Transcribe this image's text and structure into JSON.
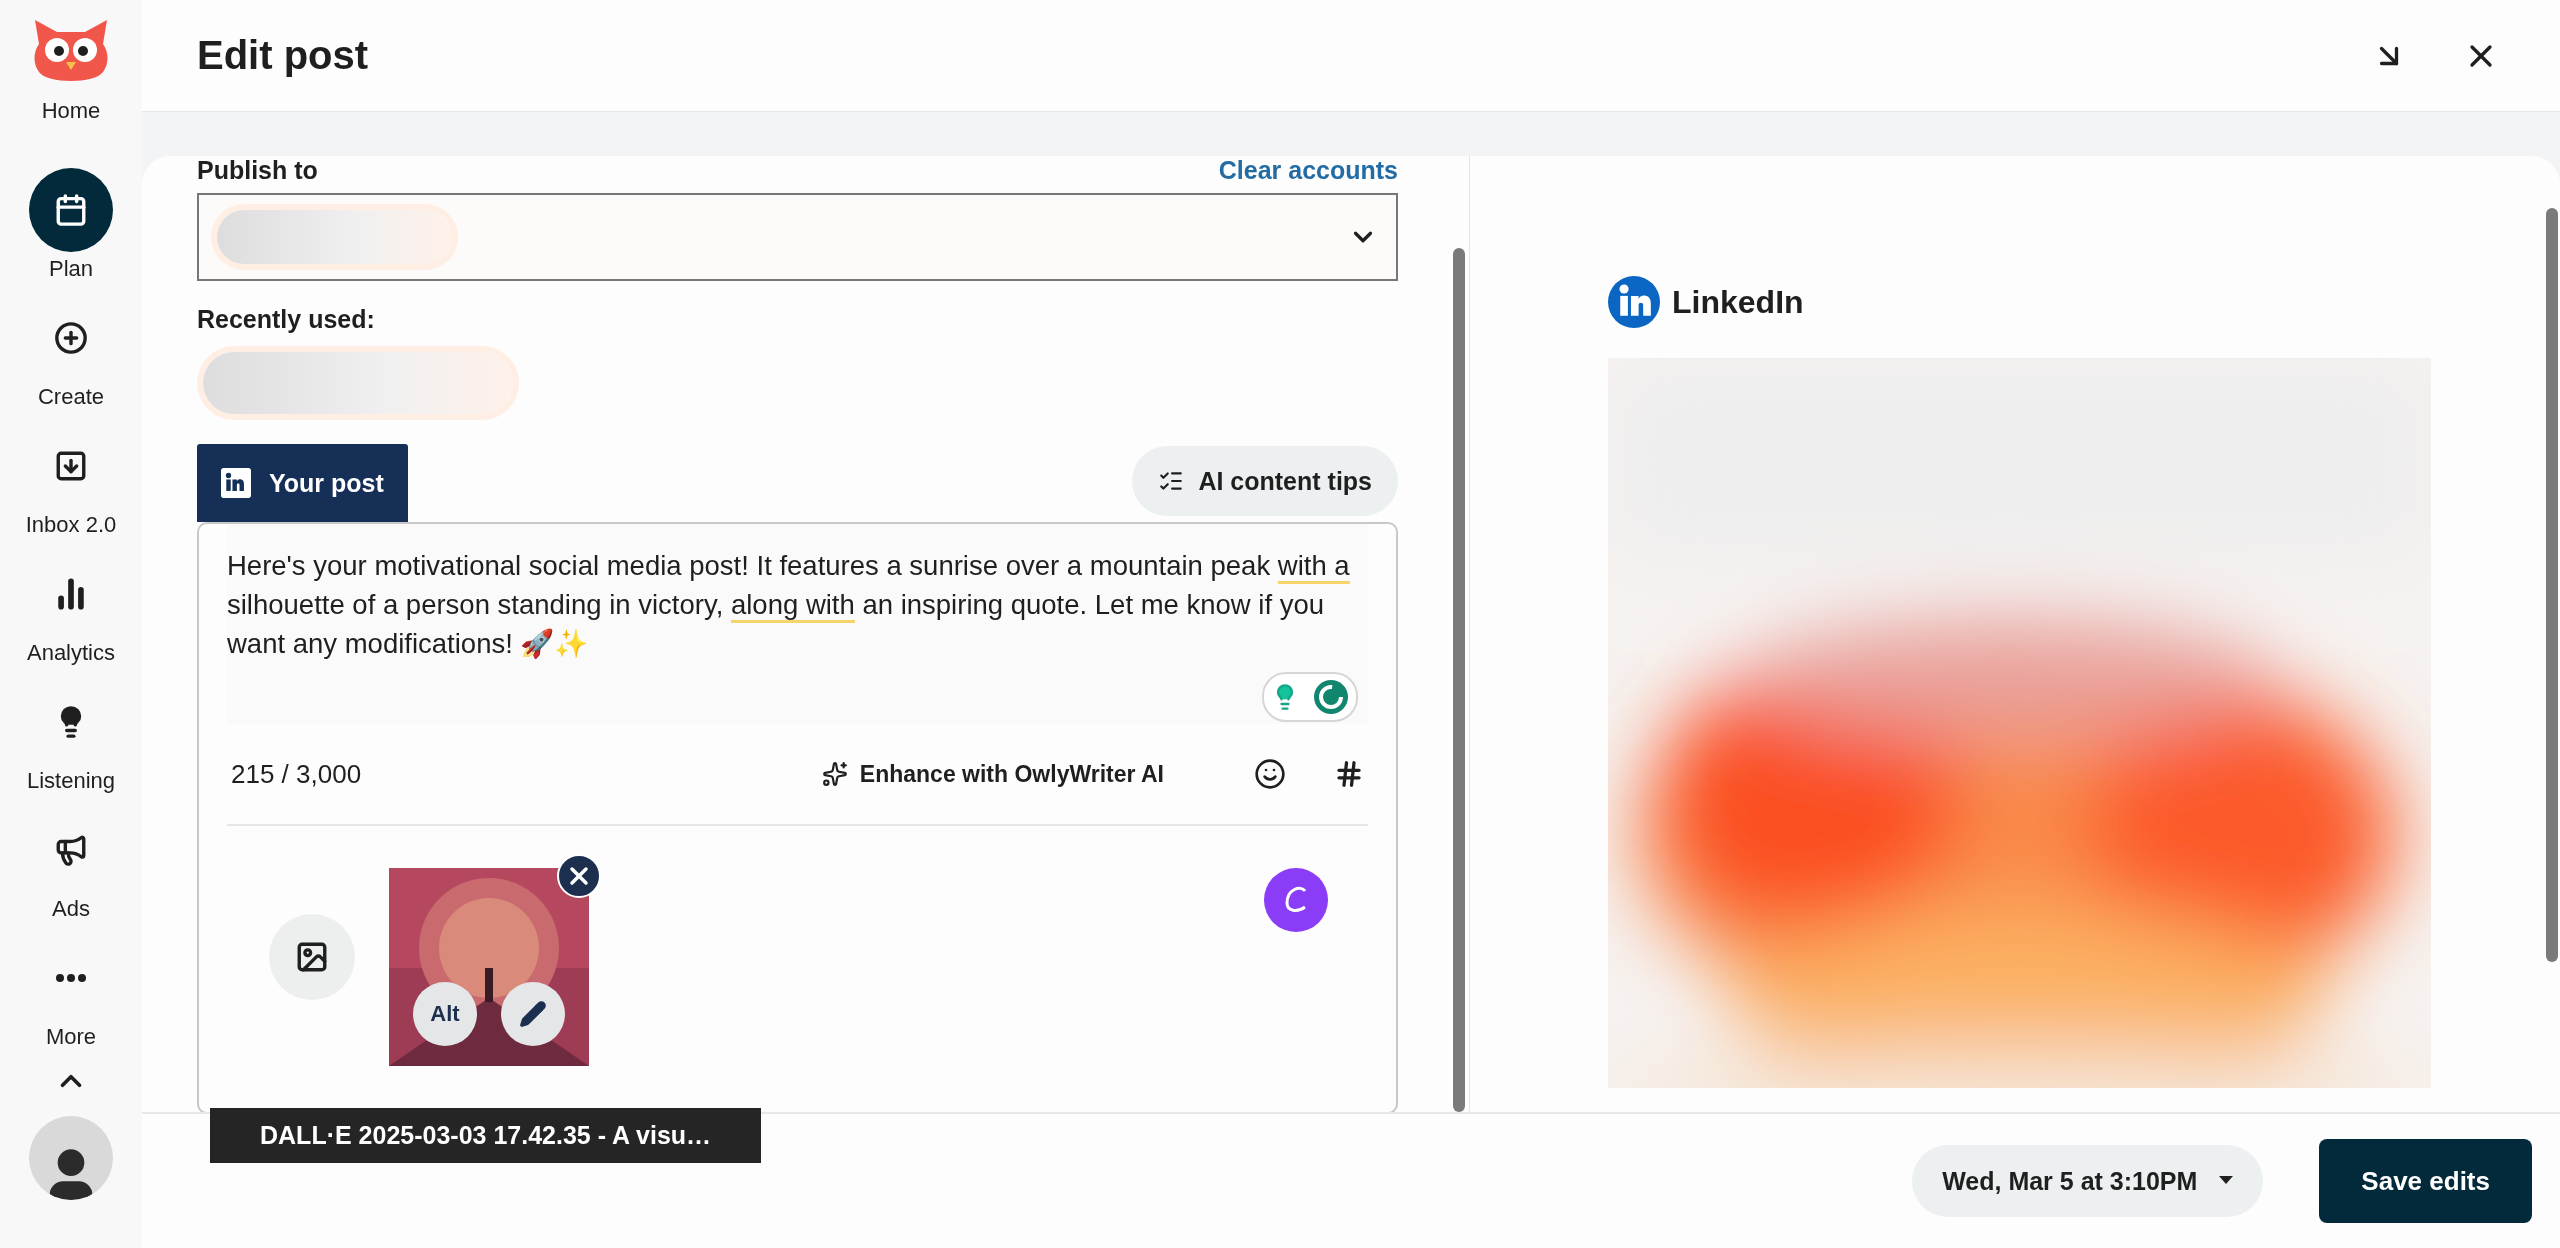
{
  "sidebar": {
    "items": [
      {
        "label": "Home",
        "kind": "logo",
        "selected": false
      },
      {
        "label": "Plan",
        "kind": "calendar",
        "selected": true
      },
      {
        "label": "Create",
        "kind": "plus",
        "selected": false
      },
      {
        "label": "Inbox 2.0",
        "kind": "inbox",
        "selected": false
      },
      {
        "label": "Analytics",
        "kind": "chart",
        "selected": false
      },
      {
        "label": "Listening",
        "kind": "bulb",
        "selected": false
      },
      {
        "label": "Ads",
        "kind": "megaphone",
        "selected": false
      },
      {
        "label": "More",
        "kind": "dots",
        "selected": false
      }
    ]
  },
  "header": {
    "title": "Edit post"
  },
  "composer": {
    "publish_label": "Publish to",
    "clear_link": "Clear accounts",
    "recent_label": "Recently used:",
    "tab": "Your post",
    "ai_tips": "AI content tips",
    "text": [
      {
        "text": "Here's your motivational social media post! It features a sunrise over a mountain peak ",
        "flagged": false
      },
      {
        "text": "with a",
        "flagged": true
      },
      {
        "text": " silhouette of a person standing in victory, ",
        "flagged": false
      },
      {
        "text": "along with",
        "flagged": true
      },
      {
        "text": " an inspiring quote. Let me know if you want any modifications! 🚀✨",
        "flagged": false
      }
    ],
    "counter": "215 / 3,000",
    "enhance": "Enhance with OwlyWriter AI",
    "attachment": {
      "alt": "Alt",
      "tooltip": "DALL·E 2025-03-03 17.42.35 - A visu…"
    }
  },
  "preview": {
    "network": "LinkedIn"
  },
  "footer": {
    "schedule": "Wed, Mar 5 at 3:10PM",
    "save": "Save edits"
  }
}
